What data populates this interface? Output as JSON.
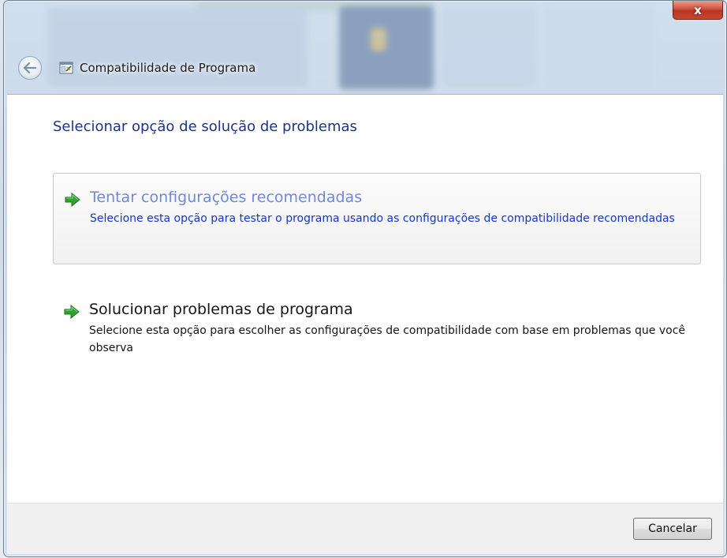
{
  "window": {
    "title": "Compatibilidade de Programa",
    "close_label": "x"
  },
  "page": {
    "heading": "Selecionar opção de solução de problemas"
  },
  "options": [
    {
      "title": "Tentar configurações recomendadas",
      "description": "Selecione esta opção para testar o programa usando as configurações de compatibilidade recomendadas",
      "icon": "green-arrow-icon"
    },
    {
      "title": "Solucionar problemas de programa",
      "description": "Selecione esta opção para escolher as configurações de compatibilidade com base em problemas que você observa",
      "icon": "green-arrow-icon"
    }
  ],
  "footer": {
    "cancel_label": "Cancelar"
  },
  "colors": {
    "heading": "#1e3287",
    "option1_title": "#6f89d9",
    "option1_desc": "#1437c3",
    "close_red": "#c44a32"
  }
}
